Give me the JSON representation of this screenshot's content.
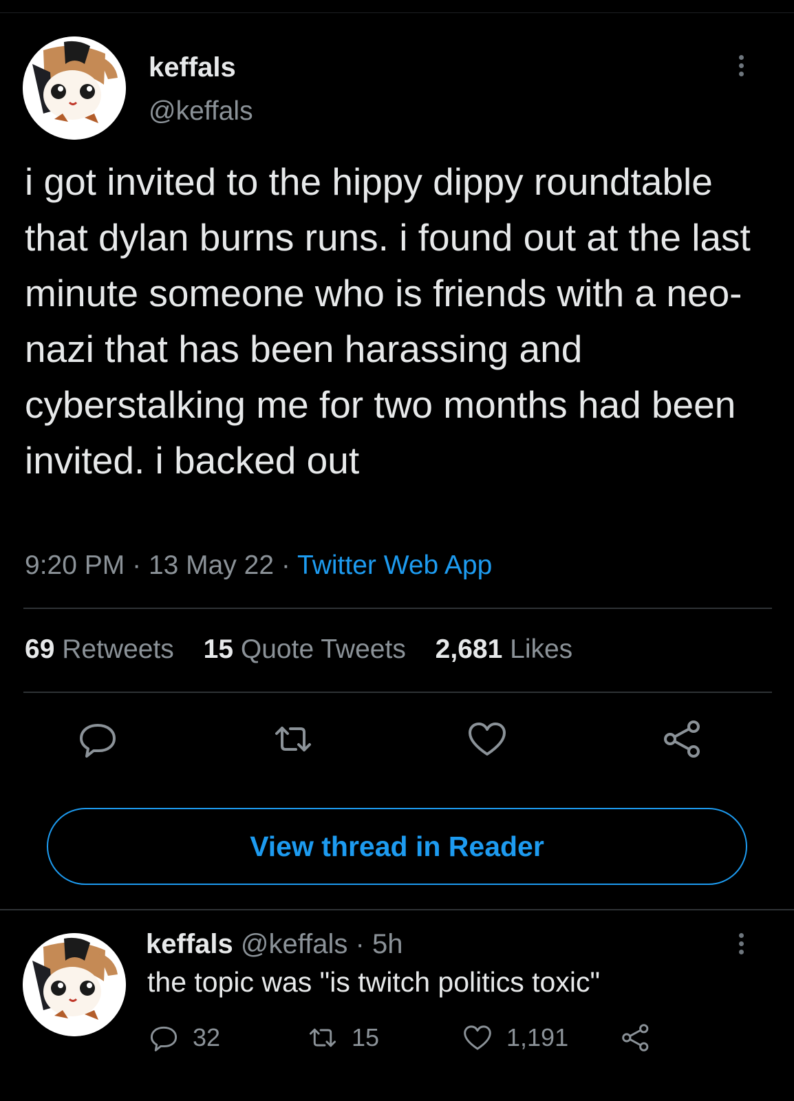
{
  "tweet": {
    "author_name": "keffals",
    "author_handle": "@keffals",
    "text": "i got invited to the hippy dippy roundtable that dylan burns runs. i found out at the last minute someone who is friends with a neo-nazi that has been harassing and cyberstalking me for two months had been invited. i backed out",
    "time": "9:20 PM",
    "date": "13 May 22",
    "separator": "·",
    "source": "Twitter Web App",
    "stats": {
      "retweets_count": "69",
      "retweets_label": "Retweets",
      "quotes_count": "15",
      "quotes_label": "Quote Tweets",
      "likes_count": "2,681",
      "likes_label": "Likes"
    },
    "actions": [
      "reply-icon",
      "retweet-icon",
      "like-icon",
      "share-icon"
    ]
  },
  "reader_button": {
    "label": "View thread in Reader"
  },
  "reply": {
    "author_name": "keffals",
    "author_handle": "@keffals",
    "separator": "·",
    "age": "5h",
    "text": "the topic was \"is twitch politics toxic\"",
    "replies": "32",
    "retweets": "15",
    "likes": "1,191"
  },
  "colors": {
    "background": "#000000",
    "text": "#e7e9ea",
    "muted": "#8b9298",
    "accent": "#1d9bf0",
    "divider": "#2f3336"
  }
}
